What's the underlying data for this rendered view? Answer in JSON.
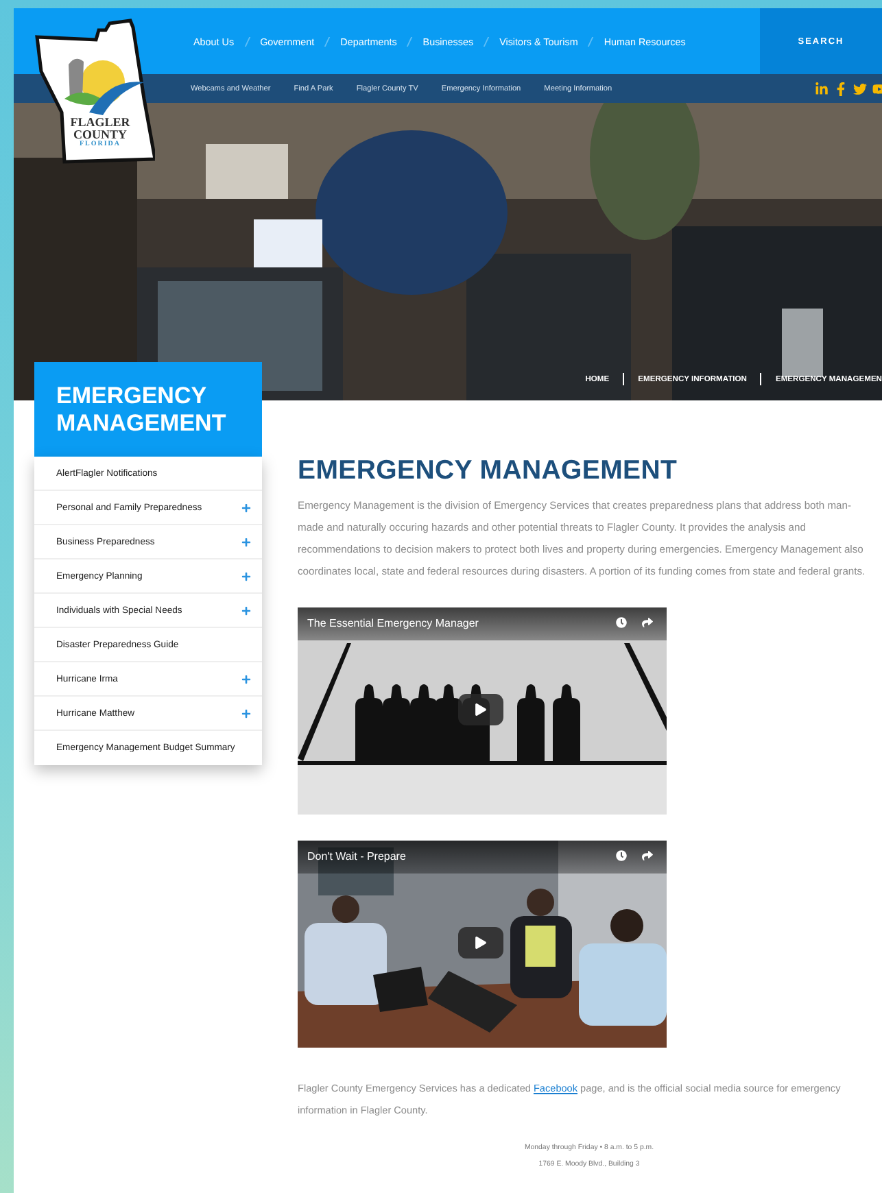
{
  "header": {
    "logo": [
      "FLAGLER",
      "COUNTY",
      "FLORIDA"
    ],
    "nav": [
      "About Us",
      "Government",
      "Departments",
      "Businesses",
      "Visitors & Tourism",
      "Human Resources"
    ],
    "search": "SEARCH",
    "subnav": [
      "Webcams and Weather",
      "Find A Park",
      "Flagler County TV",
      "Emergency Information",
      "Meeting Information"
    ]
  },
  "hero": {
    "breadcrumb": [
      "HOME",
      "EMERGENCY INFORMATION",
      "EMERGENCY MANAGEMEN"
    ]
  },
  "sidebar": {
    "title": "EMERGENCY MANAGEMENT",
    "items": [
      {
        "label": "AlertFlagler Notifications",
        "expandable": false
      },
      {
        "label": "Personal and Family Preparedness",
        "expandable": true
      },
      {
        "label": "Business Preparedness",
        "expandable": true
      },
      {
        "label": "Emergency Planning",
        "expandable": true
      },
      {
        "label": "Individuals with Special Needs",
        "expandable": true
      },
      {
        "label": "Disaster Preparedness Guide",
        "expandable": false
      },
      {
        "label": "Hurricane Irma",
        "expandable": true
      },
      {
        "label": "Hurricane Matthew",
        "expandable": true
      },
      {
        "label": "Emergency Management Budget Summary",
        "expandable": false
      }
    ]
  },
  "main": {
    "title": "EMERGENCY MANAGEMENT",
    "intro": "Emergency Management is the division of Emergency Services that creates preparedness plans that address both man-made and naturally occuring hazards and other potential threats to Flagler County. It provides the analysis and recommendations to decision makers to protect both lives and property during emergencies. Emergency Management also coordinates local, state and federal resources during disasters. A portion of its funding comes from state and federal grants.",
    "videos": [
      {
        "title": "The Essential Emergency Manager"
      },
      {
        "title": "Don't Wait - Prepare"
      }
    ],
    "social_note": {
      "before": "Flagler County Emergency Services has a dedicated ",
      "link": "Facebook",
      "after": " page, and is the official social media source for emergency information in Flagler County."
    },
    "contact": [
      "Monday through Friday • 8 a.m. to 5 p.m.",
      "1769 E. Moody Blvd., Building 3"
    ]
  }
}
